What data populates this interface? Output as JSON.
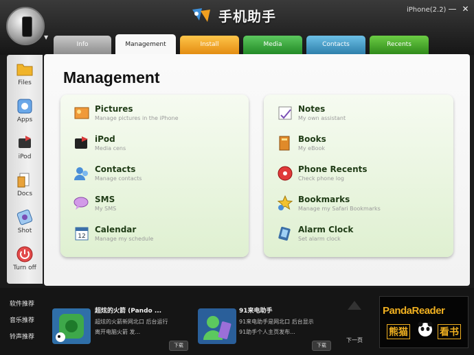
{
  "app": {
    "title": "手机助手",
    "device": "iPhone(2.2)",
    "minimize": "—",
    "close": "✕"
  },
  "tabs": [
    {
      "label": "Info",
      "color": "#a9a9a9"
    },
    {
      "label": "Management",
      "color": "#ffffff"
    },
    {
      "label": "Install",
      "color": "#f2a51f"
    },
    {
      "label": "Media",
      "color": "#36a83a"
    },
    {
      "label": "Contacts",
      "color": "#4a9bc7"
    },
    {
      "label": "Recents",
      "color": "#4ea72f"
    }
  ],
  "sidebar": {
    "items": [
      {
        "label": "Files",
        "icon": "folder-icon"
      },
      {
        "label": "Apps",
        "icon": "apps-icon"
      },
      {
        "label": "iPod",
        "icon": "ipod-icon"
      },
      {
        "label": "Docs",
        "icon": "docs-icon"
      },
      {
        "label": "Shot",
        "icon": "camera-icon"
      },
      {
        "label": "Turn off",
        "icon": "power-icon"
      }
    ]
  },
  "main": {
    "title": "Management",
    "left": [
      {
        "title": "Pictures",
        "desc": "Manage pictures in the iPhone",
        "icon": "pictures-icon"
      },
      {
        "title": "iPod",
        "desc": "Media cens",
        "icon": "ipod-media-icon"
      },
      {
        "title": "Contacts",
        "desc": "Manage contacts",
        "icon": "contacts-icon"
      },
      {
        "title": "SMS",
        "desc": "My SMS",
        "icon": "sms-icon"
      },
      {
        "title": "Calendar",
        "desc": "Manage my schedule",
        "icon": "calendar-icon"
      }
    ],
    "right": [
      {
        "title": "Notes",
        "desc": "My own assistant",
        "icon": "notes-icon"
      },
      {
        "title": "Books",
        "desc": "My eBook",
        "icon": "books-icon"
      },
      {
        "title": "Phone Recents",
        "desc": "Check phone log",
        "icon": "phone-icon"
      },
      {
        "title": "Bookmarks",
        "desc": "Manage my Safari Bookmarks",
        "icon": "bookmarks-icon"
      },
      {
        "title": "Alarm Clock",
        "desc": "Set alarm clock",
        "icon": "alarm-icon"
      }
    ]
  },
  "bottom": {
    "links": [
      "软件推荐",
      "音乐推荐",
      "铃声推荐"
    ],
    "cards": [
      {
        "title": "超炫的火箭 (Pando ...",
        "line1": "超炫的火箭新网北口 后台运行",
        "line2": "离开电脑火箭 发...",
        "button": "下载"
      },
      {
        "title": "91来电助手",
        "line1": "91来电助手是网北口 后台显示",
        "line2": "91助手个人主页发布...",
        "button": "下载"
      }
    ],
    "next": "下一页",
    "banner": {
      "brand": "PandaReader",
      "left": "熊猫",
      "right": "看书"
    }
  }
}
